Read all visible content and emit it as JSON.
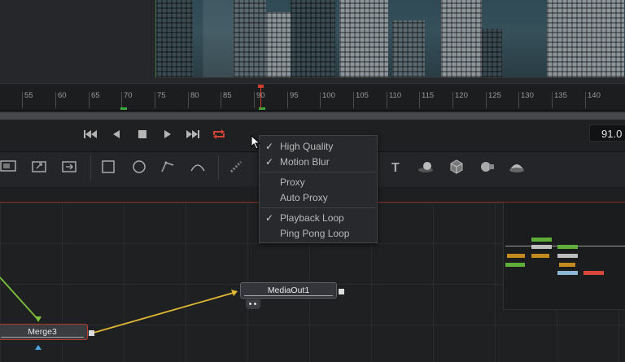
{
  "timeline": {
    "ticks": [
      "55",
      "60",
      "65",
      "70",
      "75",
      "80",
      "85",
      "90",
      "95",
      "100",
      "105",
      "110",
      "115",
      "120",
      "125",
      "130",
      "135",
      "140"
    ],
    "current_frame": "91.0"
  },
  "transport": {
    "icons": [
      "skip-to-start-icon",
      "step-back-icon",
      "stop-icon",
      "play-icon",
      "skip-to-end-icon",
      "loop-icon"
    ],
    "loop_color": "#d04433"
  },
  "context_menu": {
    "items": [
      {
        "label": "High Quality",
        "checked": "✓"
      },
      {
        "label": "Motion Blur",
        "checked": "✓"
      },
      {
        "label": "Proxy",
        "checked": ""
      },
      {
        "label": "Auto Proxy",
        "checked": ""
      },
      {
        "label": "Playback Loop",
        "checked": "✓"
      },
      {
        "label": "Ping Pong Loop",
        "checked": ""
      }
    ]
  },
  "nodes": {
    "mediaout": "MediaOut1",
    "merge": "Merge3"
  },
  "colors": {
    "accent_red": "#d0402f",
    "link_yellow": "#e0b834",
    "link_green": "#7cc23a",
    "in_marker_green": "#38a838"
  }
}
